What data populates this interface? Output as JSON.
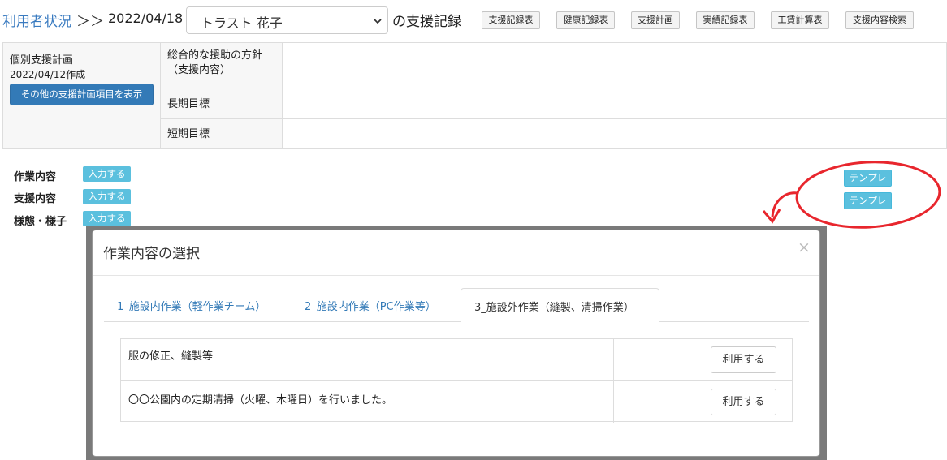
{
  "header": {
    "breadcrumb_link": "利用者状況",
    "breadcrumb_arrow": "＞＞",
    "date": "2022/04/18",
    "user_select_value": "トラスト 花子",
    "title_suffix": "の支援記録",
    "nav_buttons": [
      "支援記録表",
      "健康記録表",
      "支援計画",
      "実績記録表",
      "工賃計算表",
      "支援内容検索"
    ]
  },
  "plan": {
    "title": "個別支援計画",
    "created": "2022/04/12作成",
    "show_more_button": "その他の支援計画項目を表示",
    "rows": [
      {
        "label": "総合的な援助の方針\n（支援内容）",
        "value": ""
      },
      {
        "label": "長期目標",
        "value": ""
      },
      {
        "label": "短期目標",
        "value": ""
      }
    ]
  },
  "inputs": [
    {
      "label": "作業内容",
      "button": "入力する"
    },
    {
      "label": "支援内容",
      "button": "入力する"
    },
    {
      "label": "様態・様子",
      "button": "入力する"
    }
  ],
  "template_buttons": [
    "テンプレ",
    "テンプレ"
  ],
  "modal": {
    "title": "作業内容の選択",
    "close": "×",
    "tabs": [
      {
        "label": "1_施設内作業（軽作業チーム）",
        "active": false
      },
      {
        "label": "2_施設内作業（PC作業等）",
        "active": false
      },
      {
        "label": "3_施設外作業（縫製、清掃作業）",
        "active": true
      }
    ],
    "rows": [
      {
        "text": "服の修正、縫製等",
        "button": "利用する"
      },
      {
        "text": "〇〇公園内の定期清掃（火曜、木曜日）を行いました。",
        "button": "利用する"
      }
    ]
  },
  "annotation_color": "#e8262d"
}
